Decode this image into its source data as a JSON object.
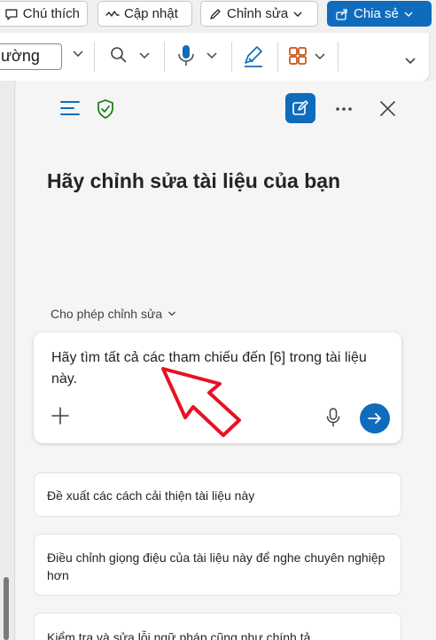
{
  "toolbar": {
    "comments_label": "Chú thích",
    "catchup_label": "Cập nhật",
    "editing_label": "Chỉnh sửa",
    "share_label": "Chia sẻ"
  },
  "ribbon": {
    "style_value": "ường"
  },
  "copilot": {
    "heading": "Hãy chỉnh sửa tài liệu của bạn",
    "permission_label": "Cho phép chỉnh sửa",
    "prompt_text": "Hãy tìm tất cả các tham chiếu đến [6] trong tài liệu này.",
    "suggestions": [
      "Đề xuất các cách cải thiện tài liệu này",
      "Điều chỉnh giọng điệu của tài liệu này để nghe chuyên nghiệp hơn",
      "Kiểm tra và sửa lỗi ngữ pháp cũng như chính tả"
    ]
  },
  "colors": {
    "accent": "#0f6cbd",
    "shield": "#107c10",
    "annotation_arrow": "#e81123"
  }
}
